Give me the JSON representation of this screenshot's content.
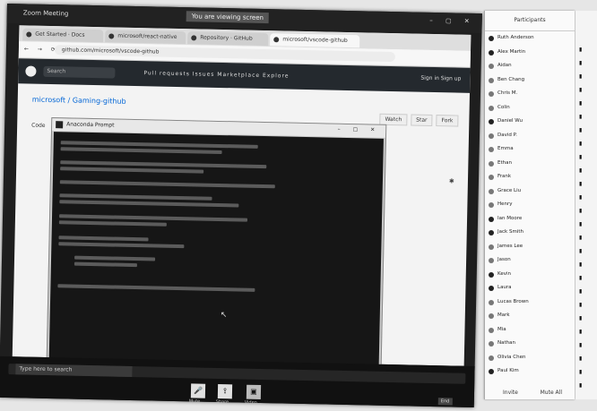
{
  "meeting": {
    "app_label": "Zoom Meeting",
    "room_label": "You are viewing screen",
    "win_controls": "– ▢ ✕",
    "taskbar_search": "Type here to search",
    "toolbar": {
      "buttons": [
        {
          "icon": "mic-icon",
          "glyph": "🎤",
          "label": "Mute"
        },
        {
          "icon": "share-icon",
          "glyph": "⇪",
          "label": "Share"
        },
        {
          "icon": "video-icon",
          "glyph": "▣",
          "label": "Video"
        }
      ],
      "end_label": "End"
    }
  },
  "browser": {
    "tabs": [
      {
        "title": "Get Started · Docs"
      },
      {
        "title": "microsoft/react-native"
      },
      {
        "title": "Repository · GitHub"
      },
      {
        "title": "microsoft/vscode-github"
      }
    ],
    "url": "github.com/microsoft/vscode-github",
    "github": {
      "search_placeholder": "Search",
      "links": "Pull requests  Issues  Marketplace  Explore",
      "signin": "Sign in  Sign up",
      "repo_title": "microsoft / Gaming-github",
      "repo_actions": [
        "Watch",
        "Star",
        "Fork"
      ],
      "repo_tab": "Code"
    }
  },
  "console": {
    "title": "Anaconda Prompt",
    "controls": "– ▢ ✕"
  },
  "participants": {
    "header": "Participants",
    "footer_left": "Invite",
    "footer_right": "Mute All",
    "items": [
      {
        "name": "Ruth Anderson",
        "color": "#222"
      },
      {
        "name": "Alex Martin",
        "color": "#222"
      },
      {
        "name": "Aidan",
        "color": "#777"
      },
      {
        "name": "Ben Chang",
        "color": "#777"
      },
      {
        "name": "Chris M.",
        "color": "#777"
      },
      {
        "name": "Colin",
        "color": "#777"
      },
      {
        "name": "Daniel Wu",
        "color": "#222"
      },
      {
        "name": "David P.",
        "color": "#777"
      },
      {
        "name": "Emma",
        "color": "#777"
      },
      {
        "name": "Ethan",
        "color": "#777"
      },
      {
        "name": "Frank",
        "color": "#777"
      },
      {
        "name": "Grace Liu",
        "color": "#777"
      },
      {
        "name": "Henry",
        "color": "#777"
      },
      {
        "name": "Ian Moore",
        "color": "#222"
      },
      {
        "name": "Jack Smith",
        "color": "#222"
      },
      {
        "name": "James Lee",
        "color": "#777"
      },
      {
        "name": "Jason",
        "color": "#777"
      },
      {
        "name": "Kevin",
        "color": "#222"
      },
      {
        "name": "Laura",
        "color": "#222"
      },
      {
        "name": "Lucas Brown",
        "color": "#777"
      },
      {
        "name": "Mark",
        "color": "#777"
      },
      {
        "name": "Mia",
        "color": "#777"
      },
      {
        "name": "Nathan",
        "color": "#777"
      },
      {
        "name": "Olivia Chen",
        "color": "#777"
      },
      {
        "name": "Paul Kim",
        "color": "#222"
      }
    ]
  }
}
